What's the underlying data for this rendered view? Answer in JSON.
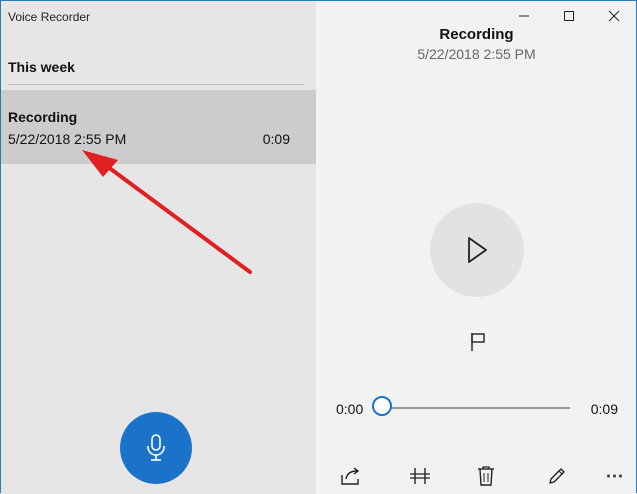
{
  "app": {
    "title": "Voice Recorder"
  },
  "list": {
    "group_header": "This week",
    "items": [
      {
        "name": "Recording",
        "date": "5/22/2018 2:55 PM",
        "duration": "0:09"
      }
    ]
  },
  "detail": {
    "title": "Recording",
    "date": "5/22/2018 2:55 PM",
    "time_current": "0:00",
    "time_total": "0:09",
    "progress": 0
  },
  "icons": {
    "record": "microphone-icon",
    "play": "play-icon",
    "flag": "flag-icon",
    "share": "share-icon",
    "trim": "trim-icon",
    "delete": "trash-icon",
    "rename": "pencil-icon",
    "more": "more-icon",
    "minimize": "minimize-icon",
    "maximize": "maximize-icon",
    "close": "close-icon"
  },
  "colors": {
    "accent": "#1a73c8",
    "selected_row": "#cccccc",
    "annotation_arrow": "#e02020"
  }
}
